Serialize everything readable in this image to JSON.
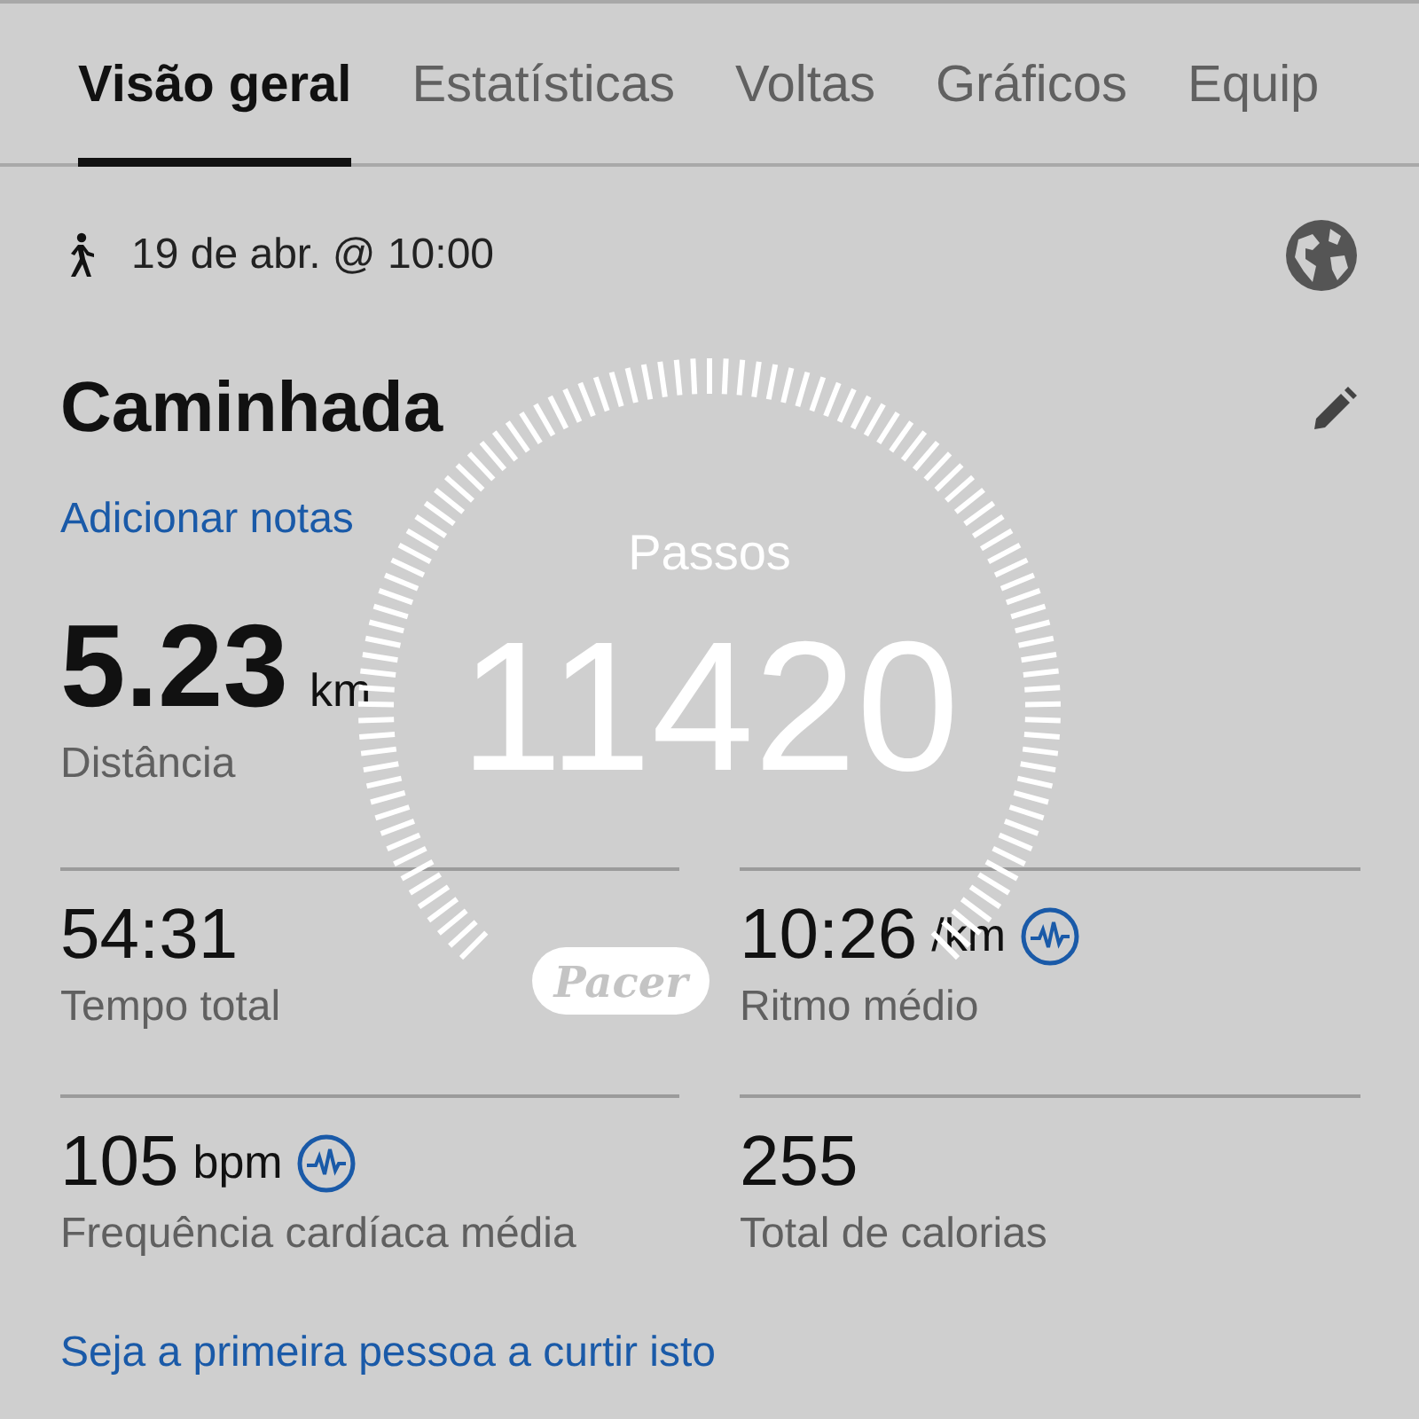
{
  "tabs": [
    {
      "label": "Visão geral",
      "selected": true
    },
    {
      "label": "Estatísticas",
      "selected": false
    },
    {
      "label": "Voltas",
      "selected": false
    },
    {
      "label": "Gráficos",
      "selected": false
    },
    {
      "label": "Equip",
      "selected": false
    }
  ],
  "activity": {
    "date": "19 de abr. @ 10:00",
    "title": "Caminhada",
    "notes_link": "Adicionar notas",
    "distance": {
      "value": "5.23",
      "unit": "km",
      "label": "Distância"
    }
  },
  "stats": [
    {
      "value": "54:31",
      "label": "Tempo total",
      "heart_rate_icon": false
    },
    {
      "value": "10:26",
      "unit": "/km",
      "label": "Ritmo médio",
      "heart_rate_icon": true
    },
    {
      "value": "105",
      "unit": "bpm",
      "label": "Frequência cardíaca média",
      "heart_rate_icon": true
    },
    {
      "value": "255",
      "label": "Total de calorias",
      "heart_rate_icon": false
    }
  ],
  "like_link": "Seja a primeira pessoa a curtir isto",
  "step_overlay": {
    "label": "Passos",
    "count": "11420",
    "badge": "Pacer"
  }
}
